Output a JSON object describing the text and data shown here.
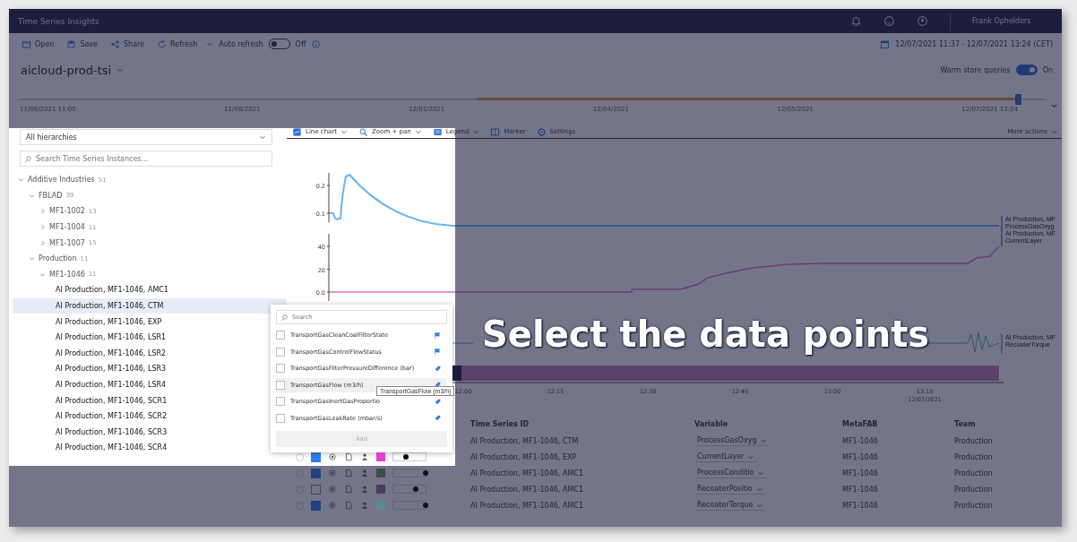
{
  "window": {
    "title": "Time Series Insights"
  },
  "header": {
    "user_name": "Frank Ophelders"
  },
  "toolbar": {
    "buttons": [
      {
        "label": "Open",
        "kind": "open"
      },
      {
        "label": "Save",
        "kind": "save"
      },
      {
        "label": "Share",
        "kind": "share"
      },
      {
        "label": "Refresh",
        "kind": "refresh"
      }
    ],
    "auto_refresh": {
      "label": "Auto refresh",
      "on": false,
      "state_text": "Off"
    },
    "time_range": "12/07/2021 11:37 - 12/07/2021 13:24 (CET)"
  },
  "environment": {
    "name": "aicloud-prod-tsi",
    "warm_store": {
      "label": "Warm store queries",
      "on": true,
      "state_text": "On"
    }
  },
  "timeline": {
    "labels": [
      "11/06/2021 11:00",
      "11/08/2021",
      "12/01/2021",
      "12/04/2021",
      "12/05/2021",
      "12/07/2021 13:24"
    ]
  },
  "chart_toolbar": {
    "items": [
      {
        "label": "Line chart",
        "kind": "chart",
        "caret": true
      },
      {
        "label": "Zoom + pan",
        "kind": "zoom",
        "caret": true
      },
      {
        "label": "Legend",
        "kind": "legend",
        "caret": true
      },
      {
        "label": "Marker",
        "kind": "marker",
        "caret": false
      },
      {
        "label": "Settings",
        "kind": "settings",
        "caret": false
      }
    ],
    "more_actions": "More actions"
  },
  "sidebar": {
    "hierarchy": "All hierarchies",
    "search": {
      "placeholder": "Search Time Series Instances..."
    },
    "tree": [
      {
        "label": "Additive Industries",
        "count": "51",
        "expanded": true,
        "children": [
          {
            "label": "FBLAD",
            "count": "39",
            "expanded": true,
            "children": [
              {
                "label": "MF1-1002",
                "count": "13",
                "expanded": false
              },
              {
                "label": "MF1-1004",
                "count": "11",
                "expanded": false
              },
              {
                "label": "MF1-1007",
                "count": "15",
                "expanded": false
              }
            ]
          },
          {
            "label": "Production",
            "count": "11",
            "expanded": true,
            "children": [
              {
                "label": "MF1-1046",
                "count": "11",
                "expanded": true,
                "children": [
                  {
                    "label": "AI Production, MF1-1046, AMC1",
                    "selected": false
                  },
                  {
                    "label": "AI Production, MF1-1046, CTM",
                    "selected": true
                  },
                  {
                    "label": "AI Production, MF1-1046, EXP",
                    "selected": false
                  },
                  {
                    "label": "AI Production, MF1-1046, LSR1",
                    "selected": false
                  },
                  {
                    "label": "AI Production, MF1-1046, LSR2",
                    "selected": false
                  },
                  {
                    "label": "AI Production, MF1-1046, LSR3",
                    "selected": false
                  },
                  {
                    "label": "AI Production, MF1-1046, LSR4",
                    "selected": false
                  },
                  {
                    "label": "AI Production, MF1-1046, SCR1",
                    "selected": false
                  },
                  {
                    "label": "AI Production, MF1-1046, SCR2",
                    "selected": false
                  },
                  {
                    "label": "AI Production, MF1-1046, SCR3",
                    "selected": false
                  },
                  {
                    "label": "AI Production, MF1-1046, SCR4",
                    "selected": false
                  }
                ]
              }
            ]
          }
        ]
      }
    ]
  },
  "chart": {
    "axis_1_ticks": [
      "0.2",
      "0.1"
    ],
    "axis_2_ticks": [
      "40",
      "20",
      "0.0"
    ],
    "time_ticks": [
      "12:00",
      "12:15",
      "12:30",
      "12:45",
      "13:00",
      "13:15"
    ],
    "time_date": "12/07/2021",
    "legend": [
      "AI Production, MF",
      "ProcessGasOxyg",
      "AI Production, MF",
      "CurrentLayer",
      "AI Production, MF",
      "RecoaterTorque"
    ]
  },
  "variable_picker": {
    "search": {
      "placeholder": "Search"
    },
    "items": [
      {
        "label": "TransportGasCleanCoalFilterState",
        "checked": false,
        "hovered": false,
        "kind": "categorical"
      },
      {
        "label": "TransportGasControlFlowStatus",
        "checked": false,
        "hovered": false,
        "kind": "categorical"
      },
      {
        "label": "TransportGasFilterPressureDifference (bar)",
        "checked": false,
        "hovered": false,
        "kind": "numeric"
      },
      {
        "label": "TransportGasFlow (m3/h)",
        "checked": false,
        "hovered": true,
        "kind": "numeric"
      },
      {
        "label": "TransportGasInertGasProportio",
        "checked": false,
        "hovered": false,
        "kind": "numeric"
      },
      {
        "label": "TransportGasLeakRate (mbar/s)",
        "checked": false,
        "hovered": false,
        "kind": "numeric"
      }
    ],
    "add_button": {
      "label": "Add",
      "disabled": true
    },
    "tooltip": "TransportGasFlow (m3/h)"
  },
  "table": {
    "columns": [
      "Time Series ID",
      "Variable",
      "MetaFAB",
      "Team"
    ],
    "rows": [
      {
        "cells": [
          "AI Production, MF1-1046, CTM",
          "ProcessGasOxyg",
          "MF1-1046",
          "Production"
        ]
      },
      {
        "selected": false,
        "checked": true,
        "color": "#e040d0",
        "level": 0.4,
        "cells": [
          "AI Production, MF1-1046, EXP",
          "CurrentLayer",
          "MF1-1046",
          "Production"
        ]
      },
      {
        "selected": false,
        "checked": true,
        "color": "#3a4f4a",
        "level": 1,
        "cells": [
          "AI Production, MF1-1046, AMC1",
          "ProcessConditio",
          "MF1-1046",
          "Production"
        ]
      },
      {
        "selected": false,
        "checked": false,
        "color": "#4a3a5e",
        "level": 0.7,
        "cells": [
          "AI Production, MF1-1046, AMC1",
          "RecoaterPositio",
          "MF1-1046",
          "Production"
        ]
      },
      {
        "selected": false,
        "checked": true,
        "color": "#5a8a90",
        "level": 1,
        "cells": [
          "AI Production, MF1-1046, AMC1",
          "RecoaterTorque",
          "MF1-1046",
          "Production"
        ]
      }
    ]
  },
  "caption": "Select the data points"
}
